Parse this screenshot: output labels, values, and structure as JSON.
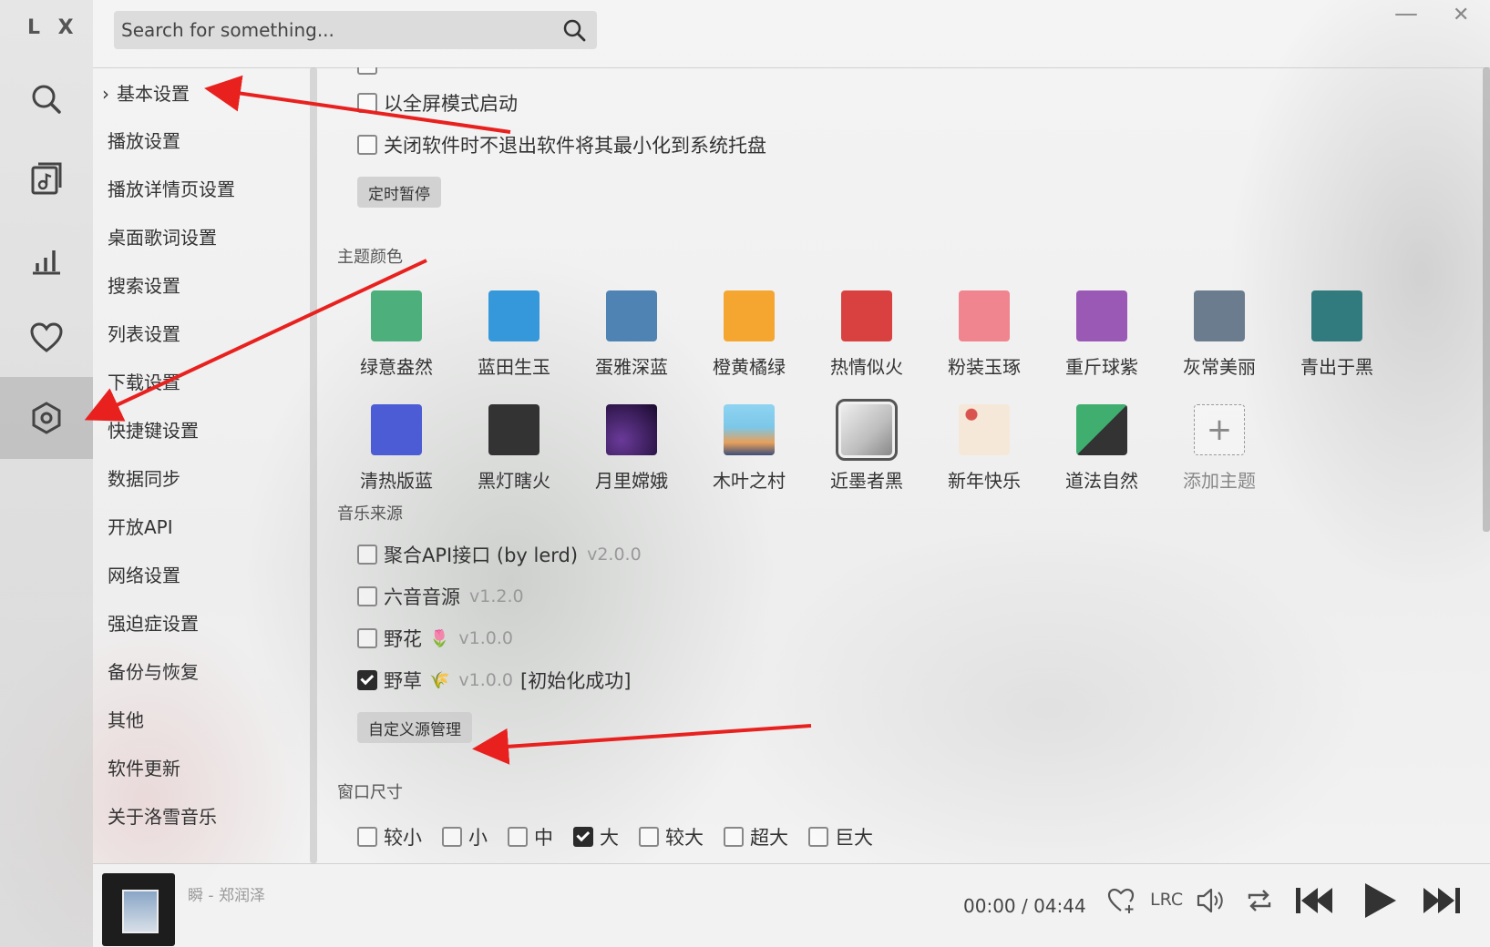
{
  "app": {
    "logo": "L X",
    "minimize_glyph": "—",
    "close_glyph": "✕"
  },
  "search": {
    "placeholder": "Search for something..."
  },
  "rail": {
    "items": [
      {
        "icon": "search-icon"
      },
      {
        "icon": "music-list-icon"
      },
      {
        "icon": "chart-icon"
      },
      {
        "icon": "heart-icon"
      },
      {
        "icon": "settings-icon",
        "active": true
      }
    ]
  },
  "nav": {
    "items": [
      {
        "label": "基本设置"
      },
      {
        "label": "播放设置"
      },
      {
        "label": "播放详情页设置"
      },
      {
        "label": "桌面歌词设置"
      },
      {
        "label": "搜索设置"
      },
      {
        "label": "列表设置"
      },
      {
        "label": "下载设置"
      },
      {
        "label": "快捷键设置"
      },
      {
        "label": "数据同步"
      },
      {
        "label": "开放API"
      },
      {
        "label": "网络设置"
      },
      {
        "label": "强迫症设置"
      },
      {
        "label": "备份与恢复"
      },
      {
        "label": "其他"
      },
      {
        "label": "软件更新"
      },
      {
        "label": "关于洛雪音乐"
      }
    ]
  },
  "basic": {
    "fullscreen_start": "以全屏模式启动",
    "minimize_to_tray": "关闭软件时不退出软件将其最小化到系统托盘",
    "timer_pause_button": "定时暂停"
  },
  "theme": {
    "section_title": "主题颜色",
    "row1": [
      {
        "name": "绿意盎然",
        "color": "#4daf7c"
      },
      {
        "name": "蓝田生玉",
        "color": "#3498db"
      },
      {
        "name": "蛋雅深蓝",
        "color": "#4f83b3"
      },
      {
        "name": "橙黄橘绿",
        "color": "#f5a631"
      },
      {
        "name": "热情似火",
        "color": "#d94141"
      },
      {
        "name": "粉装玉琢",
        "color": "#f0848f"
      },
      {
        "name": "重斤球紫",
        "color": "#9b59b6"
      },
      {
        "name": "灰常美丽",
        "color": "#6b7c8e"
      },
      {
        "name": "青出于黑",
        "color": "#317a7e"
      }
    ],
    "row2": [
      {
        "name": "清热版蓝",
        "color": "#4b5cd4"
      },
      {
        "name": "黑灯瞎火",
        "color": "#333333"
      },
      {
        "name": "月里嫦娥",
        "color": "#2a1440"
      },
      {
        "name": "木叶之村",
        "color": "#7cc7e8"
      },
      {
        "name": "近墨者黑",
        "color": "#cfcfcf",
        "selected": true
      },
      {
        "name": "新年快乐",
        "color": "#f5e8d8"
      },
      {
        "name": "道法自然",
        "color": "#3fae6f"
      }
    ],
    "add_label": "添加主题",
    "add_glyph": "+"
  },
  "source": {
    "section_title": "音乐来源",
    "items": [
      {
        "name": "聚合API接口 (by lerd)",
        "emoji": "",
        "version": "v2.0.0",
        "status": "",
        "checked": false
      },
      {
        "name": "六音音源",
        "emoji": "",
        "version": "v1.2.0",
        "status": "",
        "checked": false
      },
      {
        "name": "野花",
        "emoji": "🌷",
        "version": "v1.0.0",
        "status": "",
        "checked": false
      },
      {
        "name": "野草",
        "emoji": "🌾",
        "version": "v1.0.0",
        "status": "[初始化成功]",
        "checked": true
      }
    ],
    "manage_button": "自定义源管理"
  },
  "window_size": {
    "section_title": "窗口尺寸",
    "options": [
      {
        "label": "较小",
        "checked": false
      },
      {
        "label": "小",
        "checked": false
      },
      {
        "label": "中",
        "checked": false
      },
      {
        "label": "大",
        "checked": true
      },
      {
        "label": "较大",
        "checked": false
      },
      {
        "label": "超大",
        "checked": false
      },
      {
        "label": "巨大",
        "checked": false
      }
    ]
  },
  "player": {
    "song": "瞬 - 郑润泽",
    "current_time": "00:00",
    "separator": "/",
    "duration": "04:44",
    "lrc_label": "LRC"
  }
}
